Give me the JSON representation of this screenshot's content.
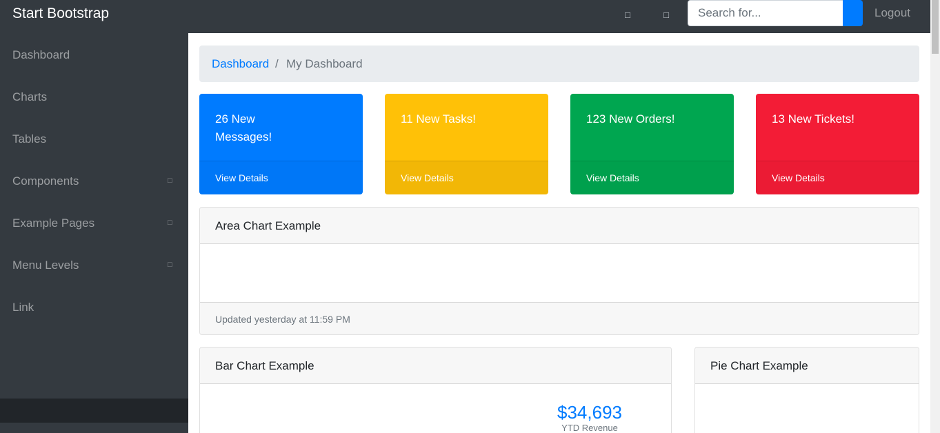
{
  "navbar": {
    "brand": "Start Bootstrap",
    "icons": [
      {
        "name": "bell-icon",
        "glyph": "□"
      },
      {
        "name": "envelope-icon",
        "glyph": "□"
      }
    ],
    "search_placeholder": "Search for...",
    "logout_label": "Logout"
  },
  "sidebar": {
    "items": [
      {
        "label": "Dashboard",
        "has_caret": false
      },
      {
        "label": "Charts",
        "has_caret": false
      },
      {
        "label": "Tables",
        "has_caret": false
      },
      {
        "label": "Components",
        "has_caret": true,
        "caret": "□"
      },
      {
        "label": "Example Pages",
        "has_caret": true,
        "caret": "□"
      },
      {
        "label": "Menu Levels",
        "has_caret": true,
        "caret": "□"
      },
      {
        "label": "Link",
        "has_caret": false
      }
    ]
  },
  "breadcrumb": {
    "link": "Dashboard",
    "separator": "/",
    "active": "My Dashboard"
  },
  "stat_cards": [
    {
      "text": "26 New Messages!",
      "footer": "View Details",
      "color": "#007bff"
    },
    {
      "text": "11 New Tasks!",
      "footer": "View Details",
      "color": "#ffc107"
    },
    {
      "text": "123 New Orders!",
      "footer": "View Details",
      "color": "#00a650"
    },
    {
      "text": "13 New Tickets!",
      "footer": "View Details",
      "color": "#f31c36"
    }
  ],
  "area_chart": {
    "title": "Area Chart Example",
    "footer": "Updated yesterday at 11:59 PM"
  },
  "bar_chart": {
    "title": "Bar Chart Example",
    "revenue_value": "$34,693",
    "revenue_label": "YTD Revenue"
  },
  "pie_chart": {
    "title": "Pie Chart Example"
  }
}
